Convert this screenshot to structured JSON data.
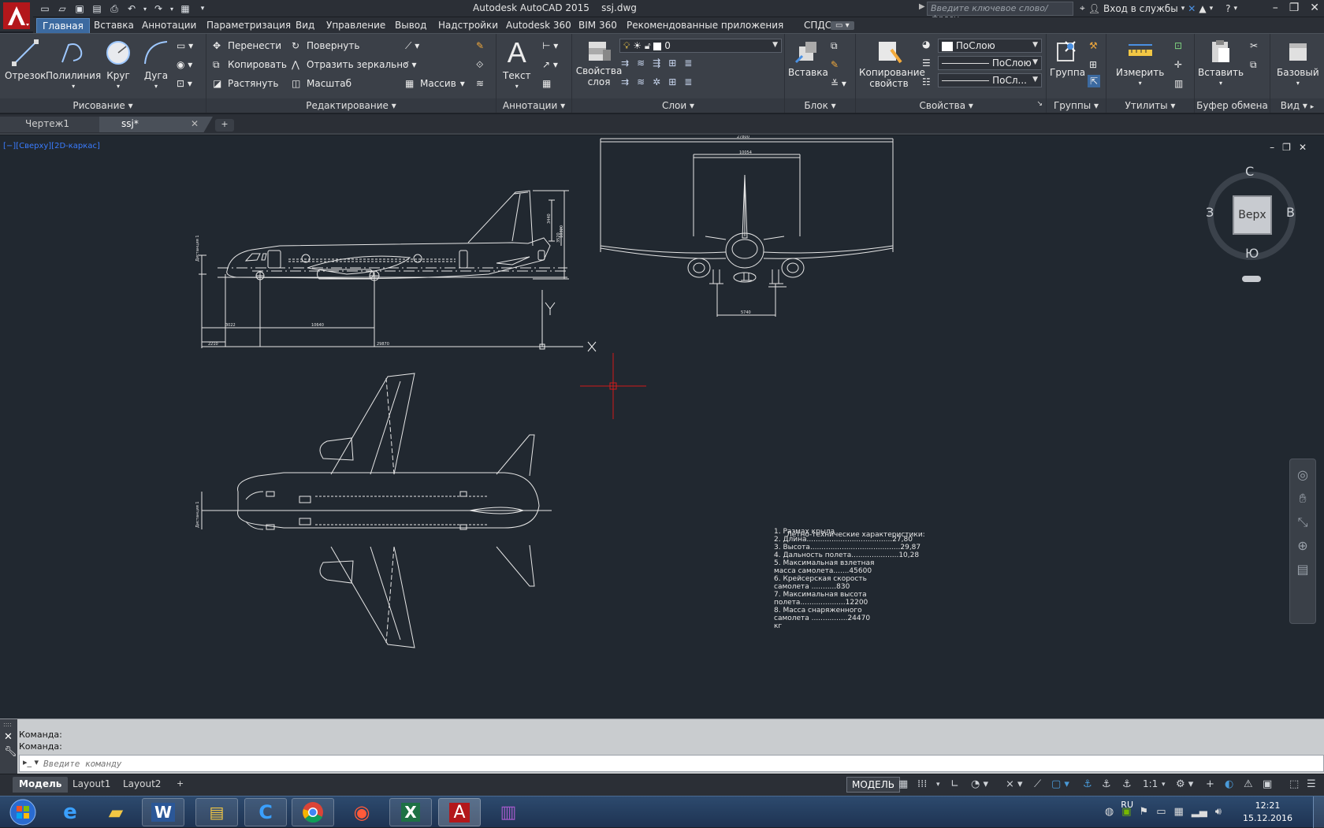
{
  "title_bar": {
    "app_title": "Autodesk AutoCAD 2015    ssj.dwg",
    "search_placeholder": "Введите ключевое слово/фразу",
    "signin_label": "Вход в службы"
  },
  "menu_tabs": [
    "Главная",
    "Вставка",
    "Аннотации",
    "Параметризация",
    "Вид",
    "Управление",
    "Вывод",
    "Надстройки",
    "Autodesk 360",
    "BIM 360",
    "Рекомендованные приложения",
    "СПДС"
  ],
  "ribbon": {
    "draw": {
      "title": "Рисование",
      "line": "Отрезок",
      "polyline": "Полилиния",
      "circle": "Круг",
      "arc": "Дуга"
    },
    "modify": {
      "title": "Редактирование",
      "move": "Перенести",
      "rotate": "Повернуть",
      "copy": "Копировать",
      "mirror": "Отразить зеркально",
      "stretch": "Растянуть",
      "scale": "Масштаб",
      "array": "Массив"
    },
    "annotation": {
      "title": "Аннотации",
      "text": "Текст"
    },
    "layers": {
      "title": "Слои",
      "properties": "Свойства слоя",
      "current_layer": "0"
    },
    "block": {
      "title": "Блок",
      "insert": "Вставка"
    },
    "properties": {
      "title": "Свойства",
      "match": "Копирование свойств",
      "color": "ПоСлою",
      "linetype": "ПоСлою",
      "lineweight": "ПоСл..."
    },
    "groups": {
      "title": "Группы",
      "group": "Группа"
    },
    "utilities": {
      "title": "Утилиты",
      "measure": "Измерить"
    },
    "clipboard": {
      "title": "Буфер обмена",
      "paste": "Вставить"
    },
    "view": {
      "title": "Вид",
      "base": "Базовый"
    }
  },
  "file_tabs": [
    {
      "label": "Чертеж1",
      "active": false
    },
    {
      "label": "ssj*",
      "active": true
    }
  ],
  "viewport": {
    "label": "[−][Сверху][2D-каркас]",
    "viewcube": {
      "top_face": "Верх",
      "north": "С",
      "south": "Ю",
      "west": "З",
      "east": "В"
    },
    "ucs_x": "X",
    "ucs_y": "Y"
  },
  "drawing": {
    "side_dims": [
      "3022",
      "10640",
      "29870",
      "10320",
      "3440",
      "2210",
      "3520"
    ],
    "front_dims": [
      "27800",
      "10054",
      "5740"
    ],
    "vertical_label": "Дистанция 1",
    "specs_title": "Лётно-технические характеристики:",
    "specs": [
      "1.   Размах крыла",
      "2. Длина......................................27,80",
      "3. Высота........................................29,87",
      "4. Дальность  полета.....................10,28",
      "5.   Максимальная  взлетная",
      "масса  самолета.......45600",
      "6.  Крейсерская скорость",
      "самолета ...........830",
      "7. Максимальная высота",
      "полета....................12200",
      "8. Масса снаряженного",
      "самолета ................24470",
      "кг"
    ]
  },
  "command_line": {
    "history": [
      "Команда:",
      "Команда:"
    ],
    "placeholder": "Введите команду"
  },
  "layout_tabs": [
    "Модель",
    "Layout1",
    "Layout2"
  ],
  "status_bar": {
    "model": "МОДЕЛЬ",
    "scale": "1:1"
  },
  "taskbar": {
    "lang": "RU",
    "time": "12:21",
    "date": "15.12.2016"
  },
  "colors": {
    "drawing_bg": "#212830",
    "ribbon_bg": "#3b4048",
    "active_tab": "#3c6aa0",
    "crosshair": "#d11a1a",
    "viewport_label": "#3a7cff"
  }
}
